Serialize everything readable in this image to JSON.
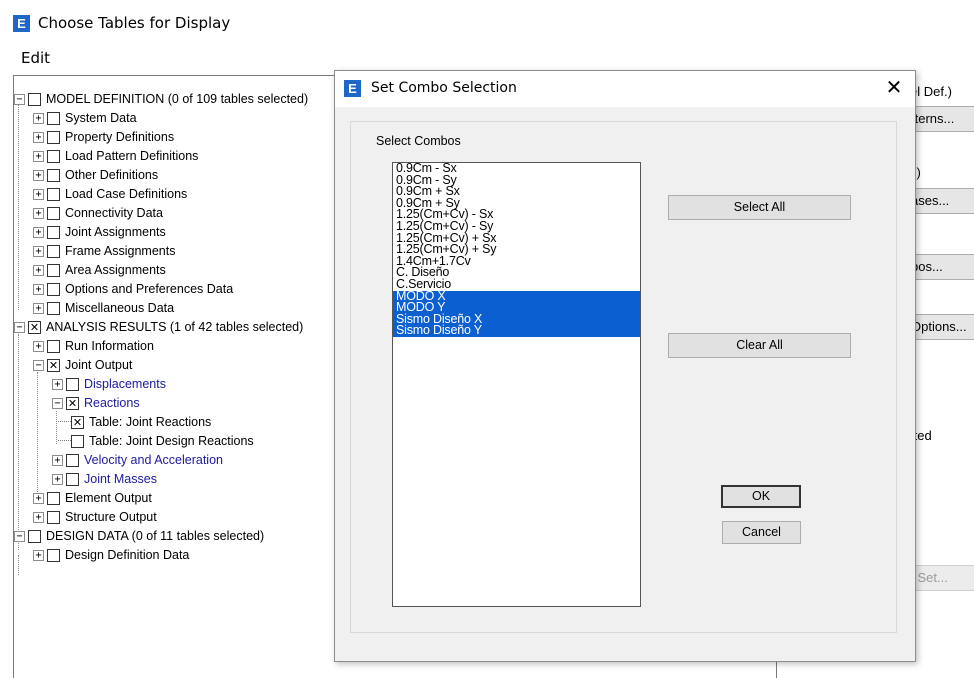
{
  "window": {
    "title": "Choose Tables for Display",
    "icon_letter": "E"
  },
  "menu": {
    "edit": "Edit"
  },
  "tree": {
    "model_definition": "MODEL DEFINITION  (0 of 109 tables selected)",
    "system_data": "System Data",
    "property_definitions": "Property Definitions",
    "load_pattern_definitions": "Load Pattern Definitions",
    "other_definitions": "Other Definitions",
    "load_case_definitions": "Load Case Definitions",
    "connectivity_data": "Connectivity Data",
    "joint_assignments": "Joint Assignments",
    "frame_assignments": "Frame Assignments",
    "area_assignments": "Area Assignments",
    "options_preferences": "Options and Preferences Data",
    "miscellaneous_data": "Miscellaneous Data",
    "analysis_results": "ANALYSIS RESULTS  (1 of 42 tables selected)",
    "run_information": "Run Information",
    "joint_output": "Joint Output",
    "displacements": "Displacements",
    "reactions": "Reactions",
    "table_joint_reactions": "Table:  Joint Reactions",
    "table_joint_design_reactions": "Table:  Joint Design Reactions",
    "velocity_acceleration": "Velocity and Acceleration",
    "joint_masses": "Joint Masses",
    "element_output": "Element Output",
    "structure_output": "Structure Output",
    "design_data": "DESIGN DATA  (0 of 11 tables selected)",
    "design_definition_data": "Design Definition Data"
  },
  "side": {
    "model_def_frag": "el Def.)",
    "patterns_btn": "tterns...",
    "cases_label": "s)",
    "cases_btn": "ases...",
    "combos_btn": "bos...",
    "options_btn": "Options...",
    "formatted_label": "tted",
    "sets_btn": "l Set..."
  },
  "dialog": {
    "title": "Set Combo Selection",
    "icon_letter": "E",
    "close": "✕",
    "group_label": "Select Combos",
    "combos": [
      {
        "label": "0.9Cm - Sx",
        "selected": false
      },
      {
        "label": "0.9Cm - Sy",
        "selected": false
      },
      {
        "label": "0.9Cm + Sx",
        "selected": false
      },
      {
        "label": "0.9Cm + Sy",
        "selected": false
      },
      {
        "label": "1.25(Cm+Cv) - Sx",
        "selected": false
      },
      {
        "label": "1.25(Cm+Cv) - Sy",
        "selected": false
      },
      {
        "label": "1.25(Cm+Cv) + Sx",
        "selected": false
      },
      {
        "label": "1.25(Cm+Cv) + Sy",
        "selected": false
      },
      {
        "label": "1.4Cm+1.7Cv",
        "selected": false
      },
      {
        "label": "C. Diseño",
        "selected": false
      },
      {
        "label": "C.Servicio",
        "selected": false
      },
      {
        "label": "MODO X",
        "selected": true
      },
      {
        "label": "MODO Y",
        "selected": true
      },
      {
        "label": "Sismo Diseño X",
        "selected": true
      },
      {
        "label": "Sismo Diseño Y",
        "selected": true
      }
    ],
    "select_all": "Select All",
    "clear_all": "Clear All",
    "ok": "OK",
    "cancel": "Cancel"
  },
  "colors": {
    "selection": "#0b5fd0",
    "icon": "#1e66c8",
    "link_blue": "#1a1aa0"
  }
}
